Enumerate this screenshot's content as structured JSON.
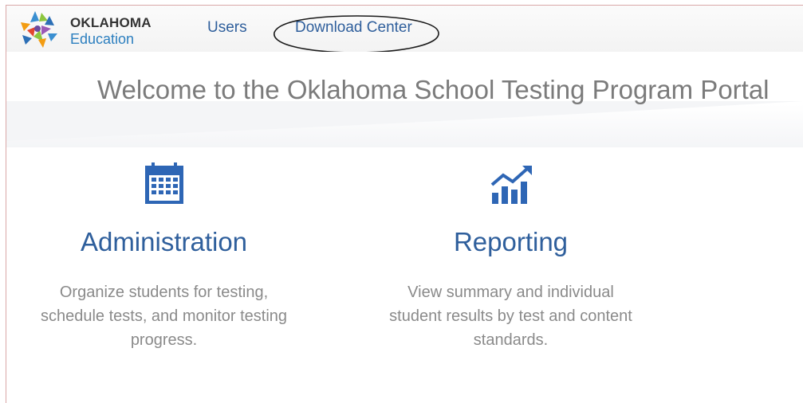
{
  "header": {
    "logo": {
      "line1": "OKLAHOMA",
      "line2": "Education"
    },
    "nav": {
      "users": "Users",
      "download_center": "Download Center"
    }
  },
  "hero": {
    "title": "Welcome to the Oklahoma School Testing Program Portal"
  },
  "tiles": [
    {
      "icon": "calendar-icon",
      "title": "Administration",
      "description": [
        "Organize students for testing,",
        "schedule tests, and monitor testing",
        "progress."
      ]
    },
    {
      "icon": "growth-chart-icon",
      "title": "Reporting",
      "description": [
        "View summary and individual",
        "student results by test and content",
        "standards."
      ]
    }
  ],
  "colors": {
    "brand_blue": "#2f5f9c",
    "icon_blue": "#2e66b5",
    "text_gray": "#8a8a8a"
  }
}
